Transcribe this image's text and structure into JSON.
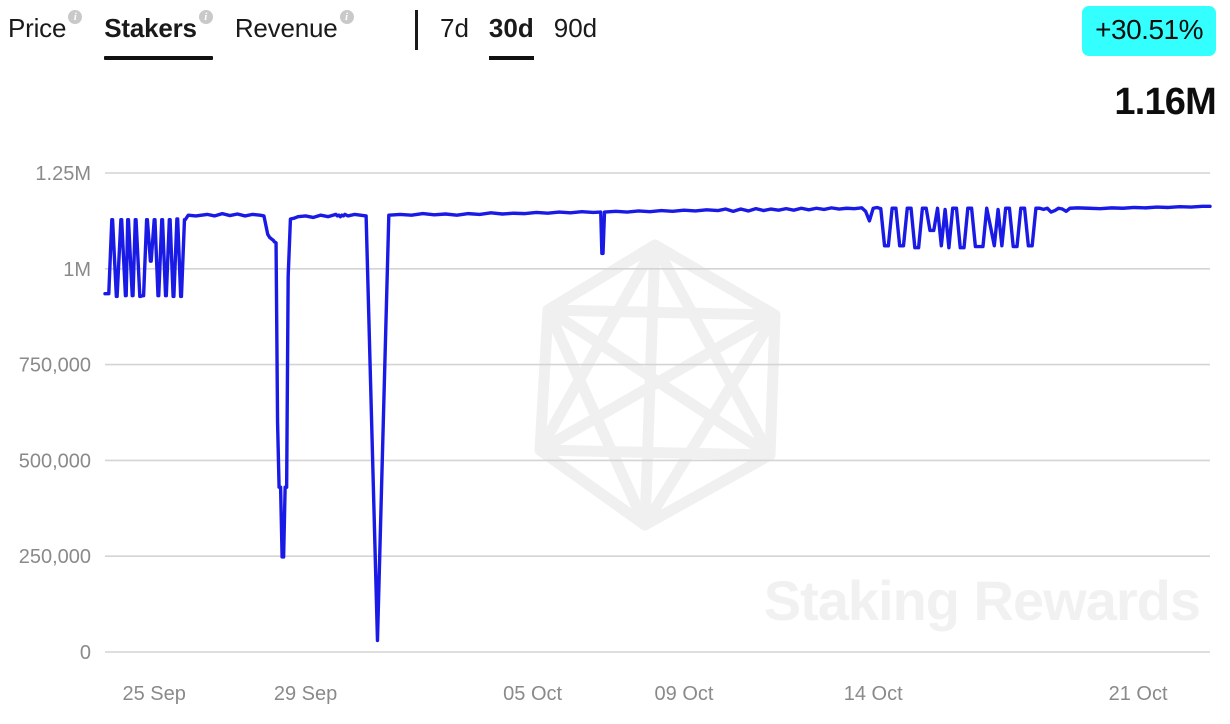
{
  "header": {
    "tabs": [
      {
        "label": "Price",
        "active": false,
        "info_icon": "info-icon"
      },
      {
        "label": "Stakers",
        "active": true,
        "info_icon": "info-icon"
      },
      {
        "label": "Revenue",
        "active": false,
        "info_icon": "info-icon"
      }
    ],
    "ranges": [
      {
        "label": "7d",
        "active": false
      },
      {
        "label": "30d",
        "active": true
      },
      {
        "label": "90d",
        "active": false
      }
    ],
    "change_badge": "+30.51%",
    "current_value": "1.16M",
    "badge_color": "#33FFFF",
    "value_color": "#0D0D0D"
  },
  "watermark": {
    "text": "Staking Rewards",
    "logo_name": "icosahedron-logo",
    "color": "#F1F1F1"
  },
  "chart_data": {
    "type": "line",
    "title": "Stakers",
    "xlabel": "",
    "ylabel": "",
    "grid": true,
    "legend_position": "none",
    "series_color": "#1A1AE6",
    "ylim": [
      0,
      1250000
    ],
    "yticks": [
      0,
      250000,
      500000,
      750000,
      1000000,
      1250000
    ],
    "ytick_labels": [
      "0",
      "250,000",
      "500,000",
      "750,000",
      "1M",
      "1.25M"
    ],
    "xticks": [
      23.3,
      27.3,
      33.3,
      37.3,
      42.3,
      49.3
    ],
    "xtick_labels": [
      "25 Sep",
      "29 Sep",
      "05 Oct",
      "09 Oct",
      "14 Oct",
      "21 Oct"
    ],
    "xlim": [
      22.0,
      51.2
    ],
    "series": [
      {
        "name": "Stakers",
        "x": [
          22.0,
          22.1,
          22.18,
          22.2,
          22.3,
          22.32,
          22.42,
          22.44,
          22.54,
          22.56,
          22.6,
          22.62,
          22.72,
          22.74,
          22.8,
          22.82,
          22.92,
          22.94,
          23.0,
          23.02,
          23.1,
          23.12,
          23.2,
          23.22,
          23.3,
          23.32,
          23.4,
          23.42,
          23.5,
          23.52,
          23.6,
          23.62,
          23.7,
          23.72,
          23.8,
          23.82,
          23.9,
          23.92,
          24.0,
          24.02,
          24.1,
          24.12,
          24.2,
          24.4,
          24.7,
          24.9,
          25.1,
          25.3,
          25.5,
          25.7,
          25.9,
          26.1,
          26.2,
          26.3,
          26.35,
          26.4,
          26.45,
          26.48,
          26.52,
          26.56,
          26.6,
          26.64,
          26.68,
          26.72,
          26.76,
          26.8,
          26.84,
          26.9,
          27.0,
          27.1,
          27.3,
          27.5,
          27.7,
          27.9,
          28.1,
          28.14,
          28.18,
          28.22,
          28.26,
          28.3,
          28.34,
          28.38,
          28.42,
          28.6,
          28.9,
          29.2,
          29.5,
          29.8,
          30.1,
          30.4,
          30.7,
          31.0,
          31.3,
          31.6,
          31.9,
          32.2,
          32.5,
          32.8,
          33.1,
          33.4,
          33.7,
          34.0,
          34.3,
          34.6,
          34.9,
          35.1,
          35.13,
          35.16,
          35.2,
          35.5,
          35.8,
          36.1,
          36.4,
          36.7,
          37.0,
          37.3,
          37.6,
          37.9,
          38.2,
          38.4,
          38.6,
          38.8,
          39.0,
          39.2,
          39.4,
          39.6,
          39.8,
          40.0,
          40.2,
          40.4,
          40.6,
          40.8,
          41.0,
          41.2,
          41.4,
          41.6,
          41.8,
          42.0,
          42.1,
          42.2,
          42.3,
          42.4,
          42.5,
          42.6,
          42.7,
          42.8,
          42.9,
          43.0,
          43.1,
          43.2,
          43.3,
          43.4,
          43.5,
          43.6,
          43.7,
          43.8,
          43.9,
          44.0,
          44.1,
          44.2,
          44.3,
          44.4,
          44.5,
          44.6,
          44.7,
          44.8,
          44.9,
          45.0,
          45.1,
          45.2,
          45.3,
          45.4,
          45.5,
          45.6,
          45.7,
          45.8,
          45.9,
          46.0,
          46.1,
          46.2,
          46.3,
          46.4,
          46.5,
          46.6,
          46.7,
          46.8,
          46.9,
          47.0,
          47.1,
          47.2,
          47.3,
          47.4,
          47.5,
          47.7,
          48.0,
          48.3,
          48.6,
          48.9,
          49.2,
          49.5,
          49.8,
          50.1,
          50.4,
          50.7,
          51.0,
          51.2
        ],
        "y": [
          935000,
          935000,
          1128000,
          1128000,
          928000,
          928000,
          1128000,
          1128000,
          930000,
          930000,
          1128000,
          1128000,
          930000,
          930000,
          1128000,
          1128000,
          928000,
          928000,
          930000,
          930000,
          1128000,
          1128000,
          1020000,
          1020000,
          1128000,
          1128000,
          930000,
          930000,
          1128000,
          1128000,
          930000,
          930000,
          1128000,
          1128000,
          928000,
          928000,
          1130000,
          1130000,
          928000,
          928000,
          1128000,
          1128000,
          1140000,
          1138000,
          1142000,
          1138000,
          1144000,
          1139000,
          1143000,
          1138000,
          1142000,
          1140000,
          1138000,
          1090000,
          1082000,
          1078000,
          1074000,
          1070000,
          1068000,
          600000,
          430000,
          430000,
          248000,
          248000,
          430000,
          430000,
          980000,
          1130000,
          1132000,
          1136000,
          1138000,
          1134000,
          1140000,
          1136000,
          1142000,
          1138000,
          1140000,
          1136000,
          1140000,
          1138000,
          1142000,
          1140000,
          1138000,
          1142000,
          1138000,
          30000,
          1140000,
          1142000,
          1140000,
          1144000,
          1141000,
          1143000,
          1140000,
          1144000,
          1142000,
          1146000,
          1143000,
          1145000,
          1144000,
          1147000,
          1145000,
          1148000,
          1146000,
          1149000,
          1147000,
          1148000,
          1040000,
          1040000,
          1148000,
          1150000,
          1148000,
          1151000,
          1149000,
          1152000,
          1150000,
          1153000,
          1151000,
          1154000,
          1152000,
          1156000,
          1150000,
          1156000,
          1151000,
          1157000,
          1152000,
          1156000,
          1153000,
          1157000,
          1153000,
          1158000,
          1154000,
          1158000,
          1155000,
          1159000,
          1156000,
          1158000,
          1157000,
          1159000,
          1150000,
          1125000,
          1158000,
          1160000,
          1157000,
          1060000,
          1060000,
          1158000,
          1158000,
          1060000,
          1060000,
          1158000,
          1158000,
          1055000,
          1055000,
          1158000,
          1158000,
          1100000,
          1100000,
          1158000,
          1060000,
          1155000,
          1055000,
          1158000,
          1158000,
          1055000,
          1055000,
          1158000,
          1158000,
          1058000,
          1058000,
          1058000,
          1158000,
          1110000,
          1060000,
          1155000,
          1060000,
          1158000,
          1158000,
          1058000,
          1058000,
          1158000,
          1158000,
          1060000,
          1060000,
          1158000,
          1158000,
          1155000,
          1158000,
          1148000,
          1152000,
          1158000,
          1156000,
          1150000,
          1158000,
          1159000,
          1158000,
          1157000,
          1159000,
          1158000,
          1160000,
          1159000,
          1161000,
          1160000,
          1162000,
          1161000,
          1163000,
          1163000
        ]
      }
    ]
  }
}
